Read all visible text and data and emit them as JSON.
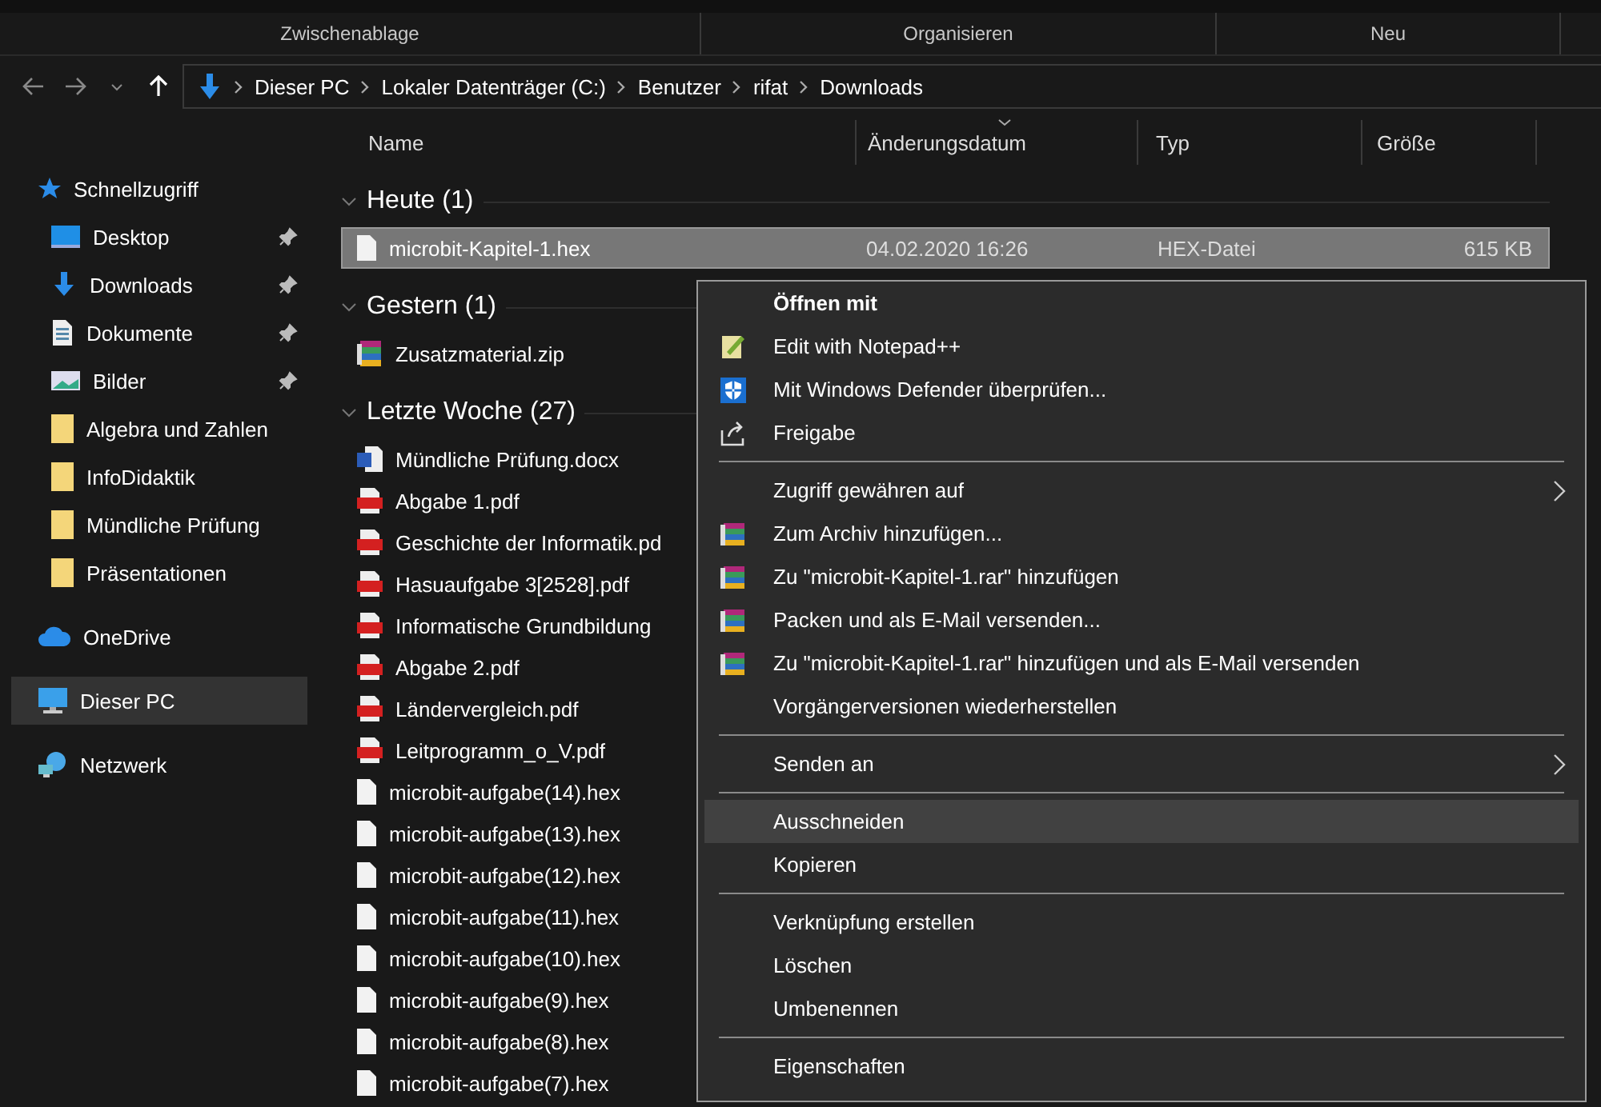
{
  "ribbon_groups": [
    "Zwischenablage",
    "Organisieren",
    "Neu"
  ],
  "address_bar": {
    "path": [
      "Dieser PC",
      "Lokaler Datenträger (C:)",
      "Benutzer",
      "rifat",
      "Downloads"
    ]
  },
  "sidebar": {
    "items": [
      {
        "label": "Schnellzugriff",
        "kind": "star",
        "selected": false,
        "children": [
          {
            "label": "Desktop",
            "kind": "desktop",
            "pinned": true,
            "selected": false
          },
          {
            "label": "Downloads",
            "kind": "download",
            "pinned": true,
            "selected": false
          },
          {
            "label": "Dokumente",
            "kind": "document",
            "pinned": true,
            "selected": false
          },
          {
            "label": "Bilder",
            "kind": "pictures",
            "pinned": true,
            "selected": false
          },
          {
            "label": "Algebra und Zahlen",
            "kind": "folder",
            "pinned": false,
            "selected": false
          },
          {
            "label": "InfoDidaktik",
            "kind": "folder",
            "pinned": false,
            "selected": false
          },
          {
            "label": "Mündliche Prüfung",
            "kind": "folder",
            "pinned": false,
            "selected": false
          },
          {
            "label": "Präsentationen",
            "kind": "folder",
            "pinned": false,
            "selected": false
          }
        ]
      },
      {
        "label": "OneDrive",
        "kind": "cloud",
        "selected": false
      },
      {
        "label": "Dieser PC",
        "kind": "pc",
        "selected": true
      },
      {
        "label": "Netzwerk",
        "kind": "network",
        "selected": false
      }
    ]
  },
  "columns": [
    {
      "label": "Name",
      "sorted": false
    },
    {
      "label": "Änderungsdatum",
      "sorted": true
    },
    {
      "label": "Typ",
      "sorted": false
    },
    {
      "label": "Größe",
      "sorted": false
    }
  ],
  "groups": [
    {
      "label": "Heute (1)",
      "expanded": true,
      "files": [
        {
          "name": "microbit-Kapitel-1.hex",
          "kind": "hex",
          "selected": true,
          "date": "04.02.2020 16:26",
          "type": "HEX-Datei",
          "size": "615 KB"
        }
      ]
    },
    {
      "label": "Gestern (1)",
      "expanded": true,
      "files": [
        {
          "name": "Zusatzmaterial.zip",
          "kind": "zip",
          "selected": false
        }
      ]
    },
    {
      "label": "Letzte Woche (27)",
      "expanded": true,
      "files": [
        {
          "name": "Mündliche Prüfung.docx",
          "kind": "docx",
          "selected": false
        },
        {
          "name": "Abgabe 1.pdf",
          "kind": "pdf",
          "selected": false
        },
        {
          "name": "Geschichte der Informatik.pd",
          "kind": "pdf",
          "selected": false
        },
        {
          "name": "Hasuaufgabe 3[2528].pdf",
          "kind": "pdf",
          "selected": false
        },
        {
          "name": "Informatische Grundbildung",
          "kind": "pdf",
          "selected": false
        },
        {
          "name": "Abgabe 2.pdf",
          "kind": "pdf",
          "selected": false
        },
        {
          "name": "Ländervergleich.pdf",
          "kind": "pdf",
          "selected": false
        },
        {
          "name": "Leitprogramm_o_V.pdf",
          "kind": "pdf",
          "selected": false
        },
        {
          "name": "microbit-aufgabe(14).hex",
          "kind": "hex",
          "selected": false
        },
        {
          "name": "microbit-aufgabe(13).hex",
          "kind": "hex",
          "selected": false
        },
        {
          "name": "microbit-aufgabe(12).hex",
          "kind": "hex",
          "selected": false
        },
        {
          "name": "microbit-aufgabe(11).hex",
          "kind": "hex",
          "selected": false
        },
        {
          "name": "microbit-aufgabe(10).hex",
          "kind": "hex",
          "selected": false
        },
        {
          "name": "microbit-aufgabe(9).hex",
          "kind": "hex",
          "selected": false
        },
        {
          "name": "microbit-aufgabe(8).hex",
          "kind": "hex",
          "selected": false
        },
        {
          "name": "microbit-aufgabe(7).hex",
          "kind": "hex",
          "selected": false
        }
      ]
    }
  ],
  "context_menu": {
    "sections": [
      [
        {
          "label": "Öffnen mit",
          "kind": "plain",
          "default": true,
          "submenu": false,
          "highlighted": false
        },
        {
          "label": "Edit with Notepad++",
          "kind": "notepad",
          "default": false,
          "submenu": false,
          "highlighted": false
        },
        {
          "label": "Mit Windows Defender überprüfen...",
          "kind": "shield",
          "default": false,
          "submenu": false,
          "highlighted": false
        },
        {
          "label": "Freigabe",
          "kind": "share",
          "default": false,
          "submenu": false,
          "highlighted": false
        }
      ],
      [
        {
          "label": "Zugriff gewähren auf",
          "kind": "plain",
          "default": false,
          "submenu": true,
          "highlighted": false
        },
        {
          "label": "Zum Archiv hinzufügen...",
          "kind": "rar",
          "default": false,
          "submenu": false,
          "highlighted": false
        },
        {
          "label": "Zu \"microbit-Kapitel-1.rar\" hinzufügen",
          "kind": "rar",
          "default": false,
          "submenu": false,
          "highlighted": false
        },
        {
          "label": "Packen und als E-Mail versenden...",
          "kind": "rar",
          "default": false,
          "submenu": false,
          "highlighted": false
        },
        {
          "label": "Zu \"microbit-Kapitel-1.rar\" hinzufügen und als E-Mail versenden",
          "kind": "rar",
          "default": false,
          "submenu": false,
          "highlighted": false
        },
        {
          "label": "Vorgängerversionen wiederherstellen",
          "kind": "plain",
          "default": false,
          "submenu": false,
          "highlighted": false
        }
      ],
      [
        {
          "label": "Senden an",
          "kind": "plain",
          "default": false,
          "submenu": true,
          "highlighted": false
        }
      ],
      [
        {
          "label": "Ausschneiden",
          "kind": "plain",
          "default": false,
          "submenu": false,
          "highlighted": true
        },
        {
          "label": "Kopieren",
          "kind": "plain",
          "default": false,
          "submenu": false,
          "highlighted": false
        }
      ],
      [
        {
          "label": "Verknüpfung erstellen",
          "kind": "plain",
          "default": false,
          "submenu": false,
          "highlighted": false
        },
        {
          "label": "Löschen",
          "kind": "plain",
          "default": false,
          "submenu": false,
          "highlighted": false
        },
        {
          "label": "Umbenennen",
          "kind": "plain",
          "default": false,
          "submenu": false,
          "highlighted": false
        }
      ],
      [
        {
          "label": "Eigenschaften",
          "kind": "plain",
          "default": false,
          "submenu": false,
          "highlighted": false
        }
      ]
    ]
  }
}
